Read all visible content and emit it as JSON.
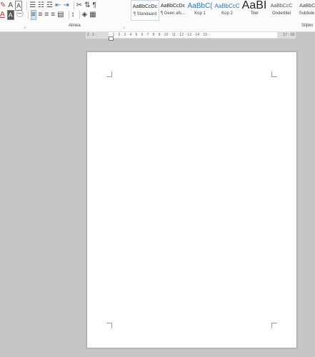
{
  "ribbon": {
    "groups": {
      "paragraph_label": "Alinea",
      "styles_label": "Stijlen"
    },
    "icons": {
      "format_painter": "✎",
      "clear_format": "A",
      "bullets": "☰",
      "numbering": "☷",
      "multilevel": "☲",
      "decrease_indent": "⇤",
      "increase_indent": "⇥",
      "asian_layout": "✂",
      "sort": "⇅",
      "show_marks": "¶",
      "font_color": "A",
      "char_shading": "A",
      "enclose": "㊀",
      "align_left": "≡",
      "align_center": "≡",
      "align_right": "≡",
      "justify": "≡",
      "distributed": "▤",
      "line_spacing": "↕",
      "shading": "◈",
      "borders": "▦"
    },
    "styles": [
      {
        "preview": "AaBbCcDc",
        "name": "¶ Standaard",
        "color": "#222222",
        "size": "7px"
      },
      {
        "preview": "AaBbCcDc",
        "name": "¶ Geen afs...",
        "color": "#222222",
        "size": "7px"
      },
      {
        "preview": "AaBbC(",
        "name": "Kop 1",
        "color": "#2e74b5",
        "size": "10px"
      },
      {
        "preview": "AaBbCcC",
        "name": "Kop 2",
        "color": "#2e74b5",
        "size": "8px"
      },
      {
        "preview": "AaBI",
        "name": "Titel",
        "color": "#222222",
        "size": "16px"
      },
      {
        "preview": "AaBbCcC",
        "name": "Ondertitel",
        "color": "#555555",
        "size": "7px"
      },
      {
        "preview": "AaBbCc",
        "name": "Subtiele b",
        "color": "#444444",
        "size": "7px"
      }
    ]
  },
  "ruler": {
    "ticks": "· 1 · 2 · 3 · 4 · 5 · 6 · 7 · 8 · 9 · 10 · 11 · 12 · 13 · 14 · 15 ·",
    "left_margin": "2 · 1 ·",
    "right_margin": "17 · 18"
  },
  "colors": {
    "canvas": "#c6c6c6",
    "ribbon": "#fbfbfb",
    "page": "#ffffff",
    "accent": "#2e74b5"
  }
}
